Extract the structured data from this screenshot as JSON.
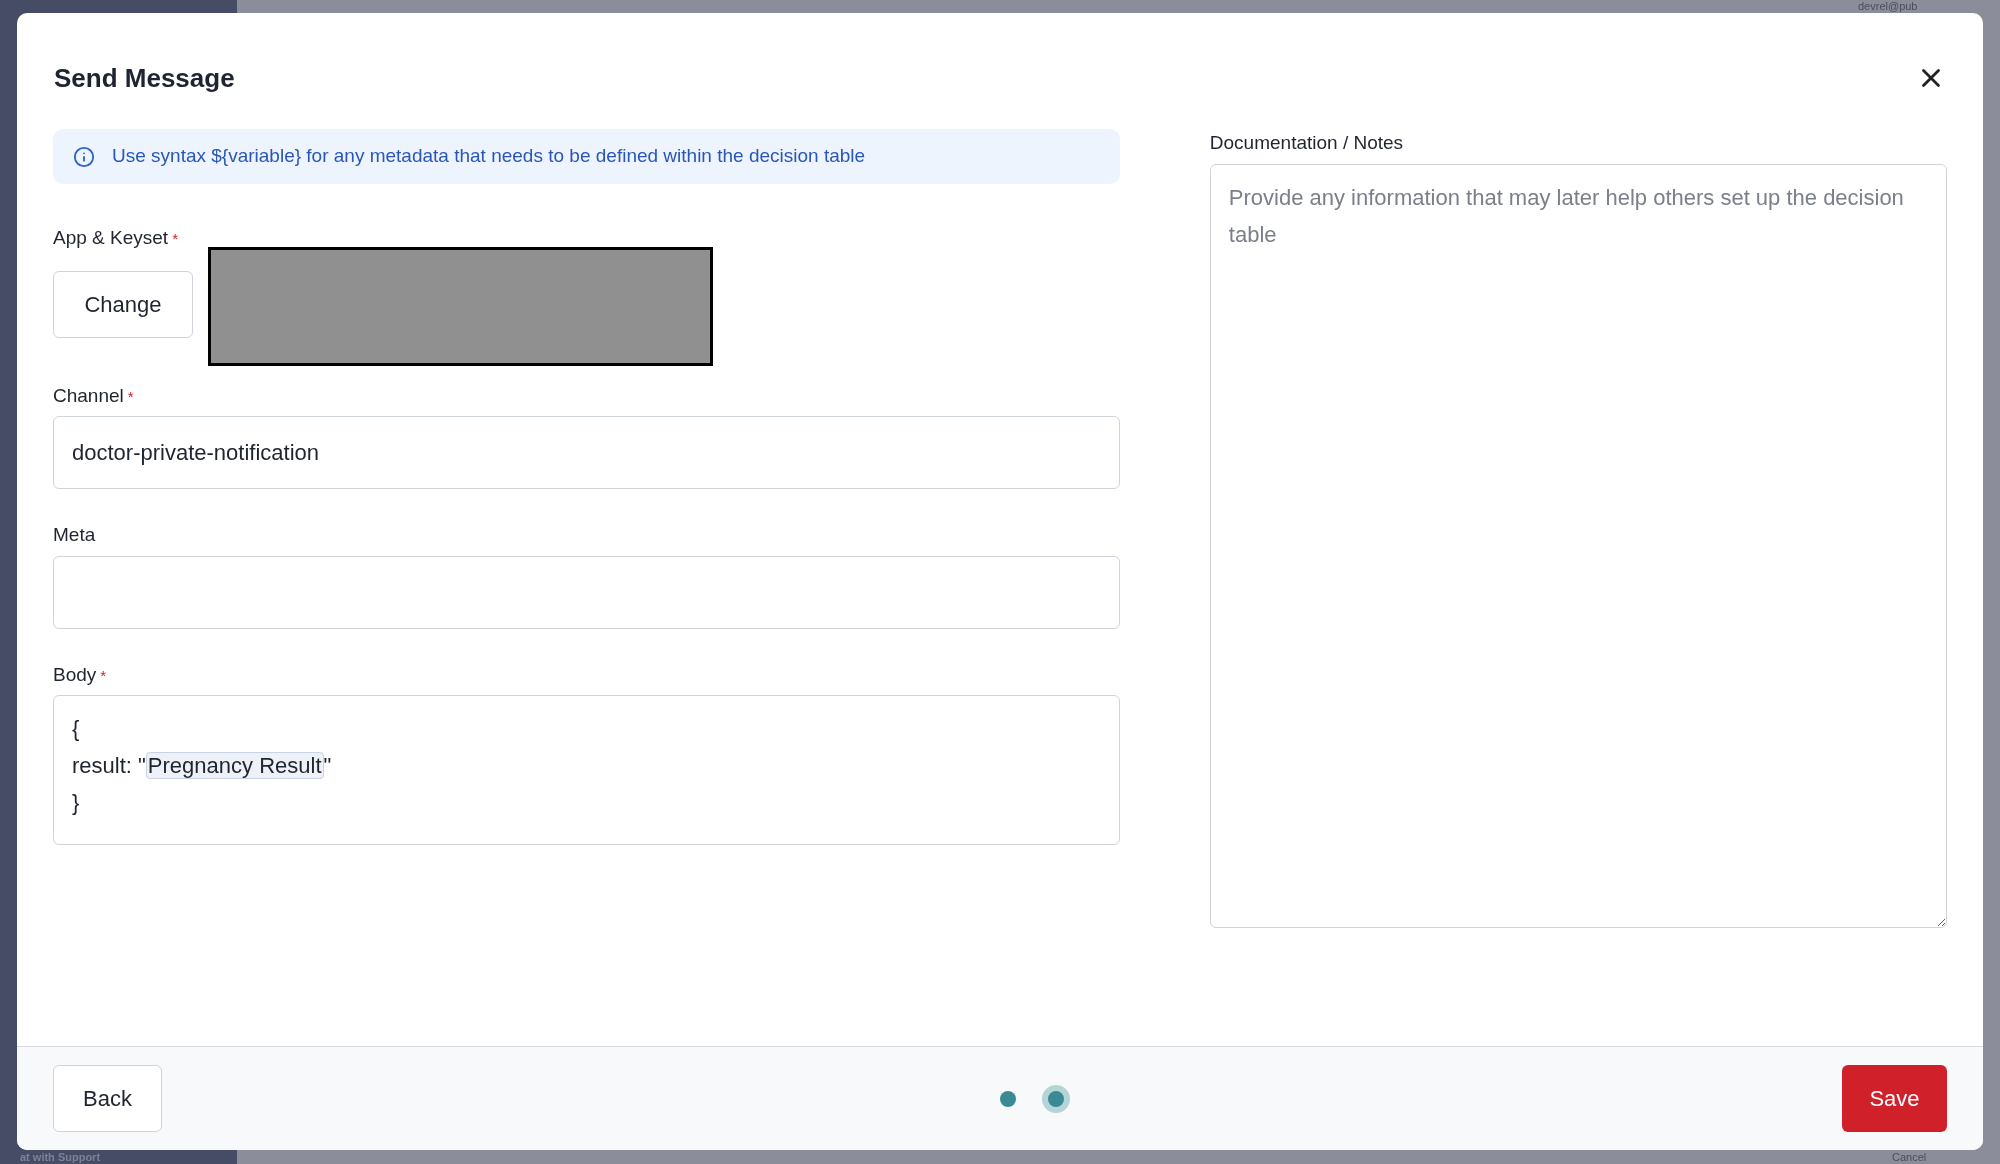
{
  "background": {
    "user_email": "devrel@pub",
    "sidebar_footer": "at with Support",
    "cancel_button": "Cancel"
  },
  "dialog": {
    "title": "Send Message",
    "info": "Use syntax ${variable} for any metadata that needs to be defined within the decision table",
    "app_keyset": {
      "label": "App & Keyset",
      "required_mark": "*",
      "button": "Change"
    },
    "channel": {
      "label": "Channel",
      "required_mark": "*",
      "value": "doctor-private-notification"
    },
    "meta": {
      "label": "Meta"
    },
    "body": {
      "label": "Body",
      "required_mark": "*",
      "lines": [
        [
          {
            "kind": "plain",
            "text": "{"
          }
        ],
        [
          {
            "kind": "plain",
            "text": "result: \""
          },
          {
            "kind": "variable",
            "text": "Pregnancy Result"
          },
          {
            "kind": "plain",
            "text": "\""
          }
        ],
        [
          {
            "kind": "plain",
            "text": "}"
          }
        ]
      ]
    },
    "notes": {
      "label": "Documentation / Notes",
      "placeholder": "Provide any information that may later help others set up the decision table"
    },
    "footer": {
      "back": "Back",
      "save": "Save",
      "steps": [
        {
          "selected": false
        },
        {
          "selected": true
        }
      ]
    }
  }
}
